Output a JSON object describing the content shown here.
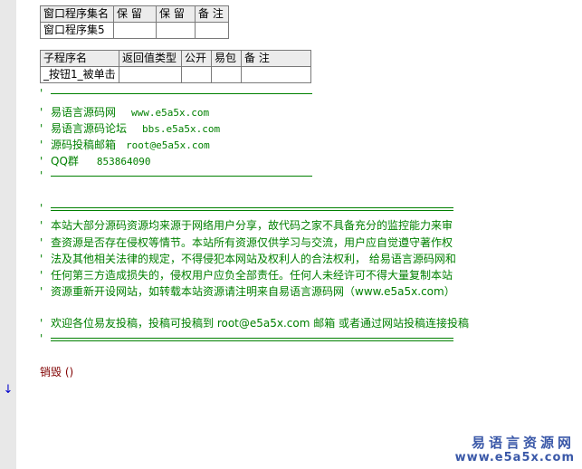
{
  "table1": {
    "headers": [
      "窗口程序集名",
      "保 留",
      "保 留",
      "备 注"
    ],
    "row": [
      "窗口程序集5",
      "",
      "",
      ""
    ]
  },
  "table2": {
    "headers": [
      "子程序名",
      "返回值类型",
      "公开",
      "易包",
      "备 注"
    ],
    "row": [
      "_按钮1_被单击",
      "",
      "",
      "",
      ""
    ]
  },
  "comment_tick": "'",
  "info": [
    {
      "label": "易语言源码网",
      "value": "www.e5a5x.com"
    },
    {
      "label": "易语言源码论坛",
      "value": "bbs.e5a5x.com"
    },
    {
      "label": "源码投稿邮箱",
      "value": "root@e5a5x.com"
    },
    {
      "label": "QQ群",
      "value": "853864090"
    }
  ],
  "notice": [
    "本站大部分源码资源均来源于网络用户分享，故代码之家不具备充分的监控能力来审",
    "查资源是否存在侵权等情节。本站所有资源仅供学习与交流，用户应自觉遵守著作权",
    "法及其他相关法律的规定，不得侵犯本网站及权利人的合法权利，  给易语言源码网和",
    "任何第三方造成损失的，侵权用户应负全部责任。任何人未经许可不得大量复制本站",
    "资源重新开设网站，如转载本站资源请注明来自易语言源码网（www.e5a5x.com）"
  ],
  "welcome": "欢迎各位易友投稿，投稿可投稿到   root@e5a5x.com  邮箱 或者通过网站投稿连接投稿",
  "code_line": "销毁 ()",
  "gutter_marker": "↓",
  "watermark": {
    "cn": "易语言资源网",
    "en": "www.e5a5x.com"
  },
  "colors": {
    "comment": "#008000",
    "command": "#800000",
    "gutter": "#e8e8e8",
    "watermark": "#3a58a8"
  }
}
